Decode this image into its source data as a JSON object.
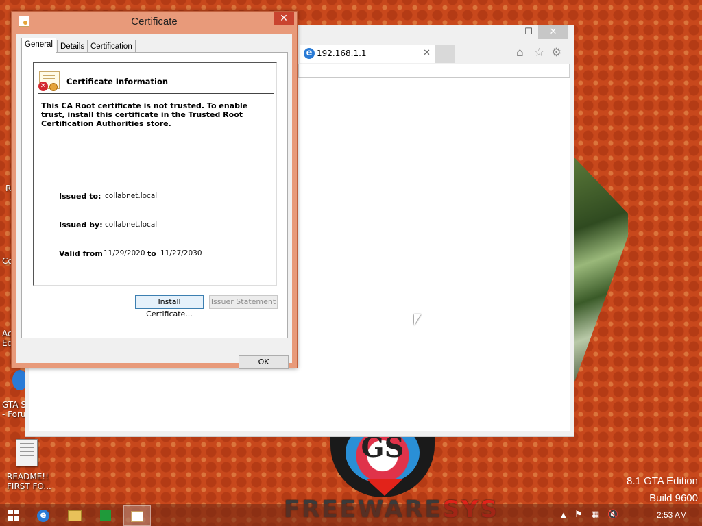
{
  "desktop": {
    "icons": [
      {
        "label": "R"
      },
      {
        "label": "Co"
      },
      {
        "label": "Ac\nEd"
      },
      {
        "label": "GTA S\n- Foru"
      },
      {
        "label": "README!!\nFIRST FO..."
      }
    ],
    "edition_line1": "8.1 GTA Edition",
    "edition_line2": "Build 9600",
    "logo_text_main": "FREEWARE",
    "logo_text_ext": "SYS"
  },
  "browser": {
    "tab_title": "192.168.1.1",
    "tab_close": "✕",
    "minimize": "—",
    "maximize": "☐",
    "close": "✕"
  },
  "dialog": {
    "title": "Certificate",
    "close_label": "✕",
    "tabs": [
      {
        "label": "General",
        "active": true
      },
      {
        "label": "Details",
        "active": false
      },
      {
        "label": "Certification Path",
        "active": false
      }
    ],
    "info_heading": "Certificate Information",
    "warning_text": "This CA Root certificate is not trusted. To enable trust, install this certificate in the Trusted Root Certification Authorities store.",
    "issued_to_label": "Issued to:",
    "issued_to_value": "collabnet.local",
    "issued_by_label": "Issued by:",
    "issued_by_value": "collabnet.local",
    "valid_from_label": "Valid from",
    "valid_from_value": "11/29/2020",
    "valid_to_label": "to",
    "valid_to_value": "11/27/2030",
    "install_button": "Install Certificate...",
    "issuer_statement_button": "Issuer Statement",
    "ok_button": "OK"
  },
  "taskbar": {
    "clock": "2:53 AM"
  },
  "colors": {
    "desktop_bg": "#c8481c",
    "dialog_frame": "#e89a7a",
    "dialog_close": "#c9442f",
    "focus_border": "#3c7fb1"
  }
}
